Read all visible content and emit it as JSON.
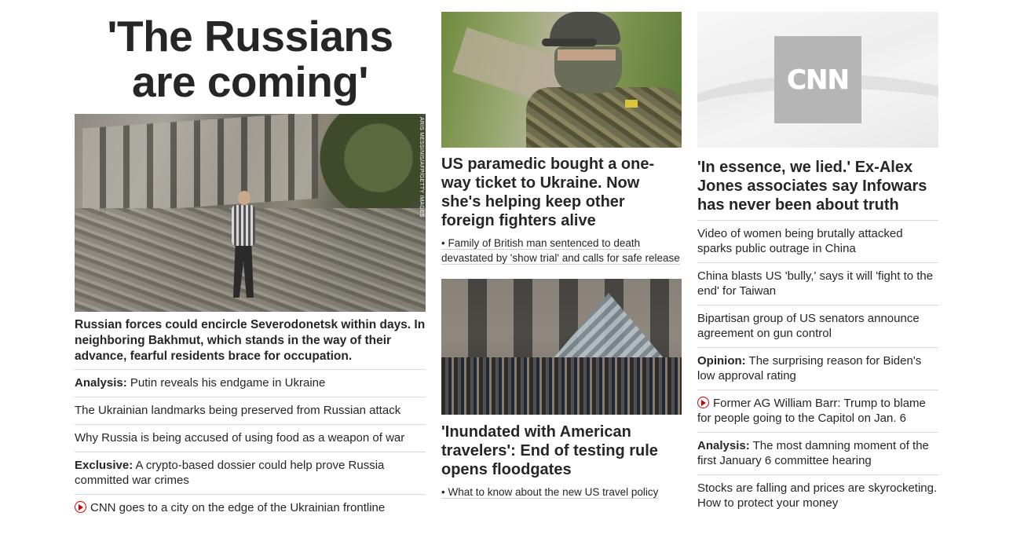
{
  "col1": {
    "big_headline": "'The Russians are coming'",
    "image_credit": "ARIS MESSINIS/AFP/GETTY IMAGES",
    "lead": "Russian forces could encircle Severodonetsk within days. In neighboring Bakhmut, which stands in the way of their advance, fearful residents brace for occupation.",
    "items": [
      {
        "label": "Analysis:",
        "text": " Putin reveals his endgame in Ukraine"
      },
      {
        "label": "",
        "text": "The Ukrainian landmarks being preserved from Russian attack"
      },
      {
        "label": "",
        "text": "Why Russia is being accused of using food as a weapon of war"
      },
      {
        "label": "Exclusive:",
        "text": " A crypto-based dossier could help prove Russia committed war crimes"
      },
      {
        "label": "",
        "text": "CNN goes to a city on the edge of the Ukrainian frontline",
        "icon": "play-icon"
      }
    ]
  },
  "col2": {
    "story1": {
      "headline": "US paramedic bought a one-way ticket to Ukraine. Now she's helping keep other foreign fighters alive",
      "sub": "• Family of British man sentenced to death devastated by 'show trial' and calls for safe release"
    },
    "story2": {
      "headline": "'Inundated with American travelers': End of testing rule opens floodgates",
      "sub": "• What to know about the new US travel policy"
    }
  },
  "col3": {
    "logo_text": "CNN",
    "headline": "'In essence, we lied.' Ex-Alex Jones associates say Infowars has never been about truth",
    "items": [
      {
        "label": "",
        "text": "Video of women being brutally attacked sparks public outrage in China"
      },
      {
        "label": "",
        "text": "China blasts US 'bully,' says it will 'fight to the end' for Taiwan"
      },
      {
        "label": "",
        "text": "Bipartisan group of US senators announce agreement on gun control"
      },
      {
        "label": "Opinion:",
        "text": " The surprising reason for Biden's low approval rating"
      },
      {
        "label": "",
        "text": "Former AG William Barr: Trump to blame for people going to the Capitol on Jan. 6",
        "icon": "play-icon"
      },
      {
        "label": "Analysis:",
        "text": " The most damning moment of the first January 6 committee hearing"
      },
      {
        "label": "",
        "text": "Stocks are falling and prices are skyrocketing. How to protect your money"
      }
    ]
  },
  "colors": {
    "accent_red": "#cc0000",
    "text": "#262626",
    "divider": "#d9d9d9"
  }
}
